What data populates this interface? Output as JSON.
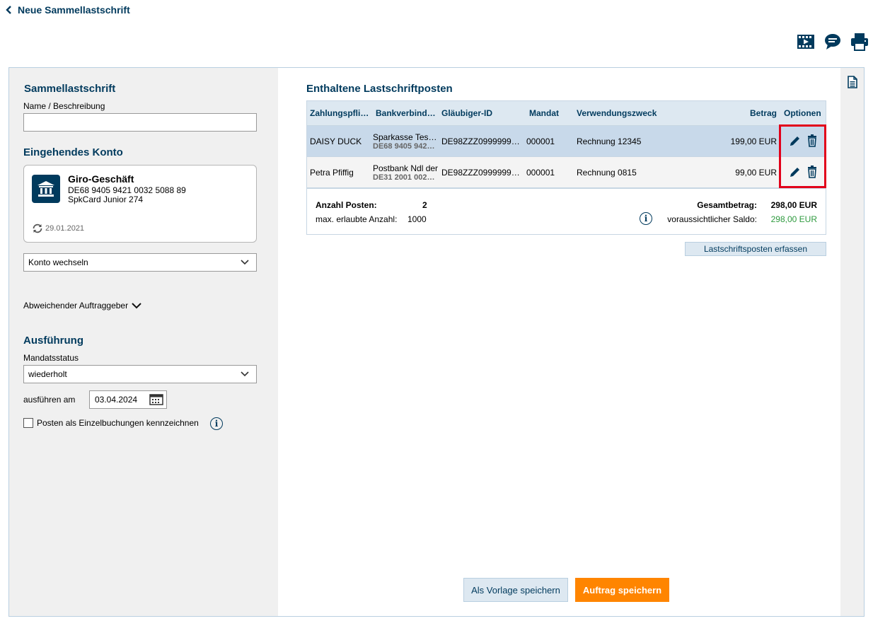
{
  "nav": {
    "back_label": "Neue Sammellastschrift"
  },
  "toolbar": {
    "icons": [
      "video-icon",
      "chat-icon",
      "print-icon"
    ]
  },
  "left": {
    "section_title": "Sammellastschrift",
    "name_label": "Name / Beschreibung",
    "name_value": "",
    "account_title": "Eingehendes Konto",
    "account": {
      "name": "Giro-Geschäft",
      "iban": "DE68 9405 9421 0032 5088 89",
      "card": "SpkCard Junior 274",
      "sync_date": "29.01.2021"
    },
    "switch_account": "Konto wechseln",
    "different_originator": "Abweichender Auftraggeber",
    "execution_title": "Ausführung",
    "mandate_status_label": "Mandatsstatus",
    "mandate_status_value": "wiederholt",
    "execute_on_label": "ausführen am",
    "execute_on_value": "03.04.2024",
    "single_booking_label": "Posten als Einzelbuchungen kennzeichnen"
  },
  "main": {
    "title": "Enthaltene Lastschriftposten",
    "columns": {
      "payer": "Zahlungspfli…",
      "bank": "Bankverbind…",
      "creditor_id": "Gläubiger-ID",
      "mandate": "Mandat",
      "purpose": "Verwendungszweck",
      "amount": "Betrag",
      "options": "Optionen"
    },
    "rows": [
      {
        "payer": "DAISY DUCK",
        "bank": "Sparkasse Testins",
        "bank_iban": "DE68 9405 942…",
        "creditor_id": "DE98ZZZ0999999…",
        "mandate": "000001",
        "purpose": "Rechnung 12345",
        "amount": "199,00 EUR"
      },
      {
        "payer": "Petra Pfiffig",
        "bank": "Postbank Ndl der",
        "bank_iban": "DE31 2001 002…",
        "creditor_id": "DE98ZZZ0999999…",
        "mandate": "000001",
        "purpose": "Rechnung 0815",
        "amount": "99,00 EUR"
      }
    ],
    "summary": {
      "count_label": "Anzahl Posten:",
      "count_value": "2",
      "max_label": "max. erlaubte Anzahl:",
      "max_value": "1000",
      "total_label": "Gesamtbetrag:",
      "total_value": "298,00 EUR",
      "balance_label": "voraussichtlicher Saldo:",
      "balance_value": "298,00 EUR"
    },
    "add_item_button": "Lastschriftsposten erfassen",
    "save_template_button": "Als Vorlage speichern",
    "save_order_button": "Auftrag speichern"
  },
  "colors": {
    "brand": "#003a5d",
    "accent": "#ff8500",
    "positive": "#2e9a3e",
    "highlight": "#e2001a"
  }
}
